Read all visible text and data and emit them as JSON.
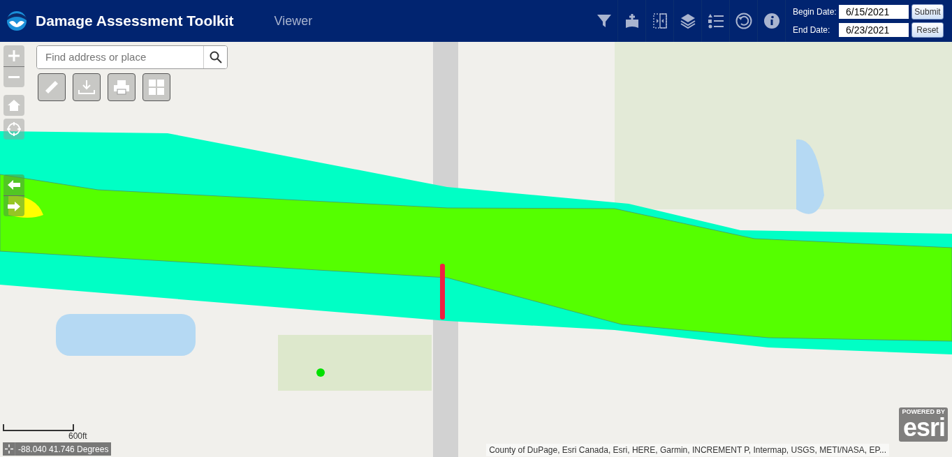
{
  "header": {
    "title": "Damage Assessment Toolkit",
    "subtitle": "Viewer"
  },
  "dates": [
    {
      "label": "Begin Date:",
      "value": "6/15/2021",
      "button": "Submit"
    },
    {
      "label": "End Date:",
      "value": "6/23/2021",
      "button": "Reset"
    }
  ],
  "map": {
    "search": {
      "placeholder": "Find address or place"
    },
    "scale": "600ft",
    "coordinates": "-88.040 41.746 Degrees",
    "attribution": "County of DuPage, Esri Canada, Esri, HERE, Garmin, INCREMENT P, Intermap, USGS, METI/NASA, EP...",
    "logo": {
      "caption": "POWERED BY",
      "name": "esri"
    }
  }
}
